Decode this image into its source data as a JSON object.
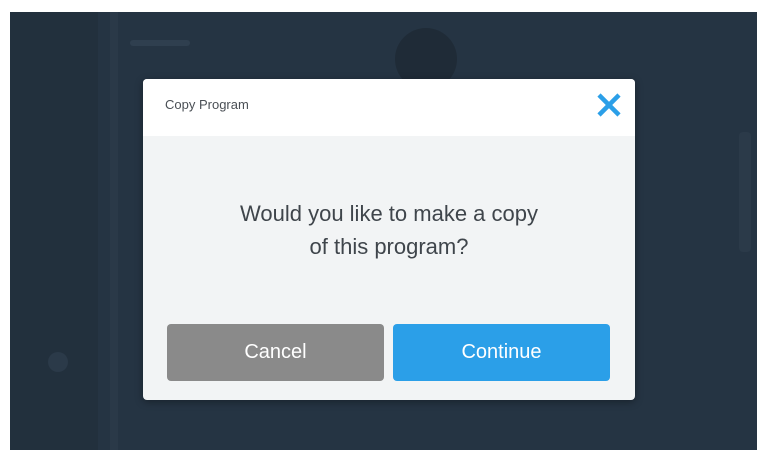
{
  "dialog": {
    "title": "Copy Program",
    "message": "Would you like to make a copy\nof this program?",
    "cancel_label": "Cancel",
    "continue_label": "Continue",
    "close_icon": "close-icon"
  },
  "colors": {
    "backdrop": "#253443",
    "dialog_body": "#f2f4f5",
    "header": "#ffffff",
    "close_icon": "#2b9fe8",
    "cancel_button": "#8a8a8a",
    "continue_button": "#2b9fe8"
  }
}
